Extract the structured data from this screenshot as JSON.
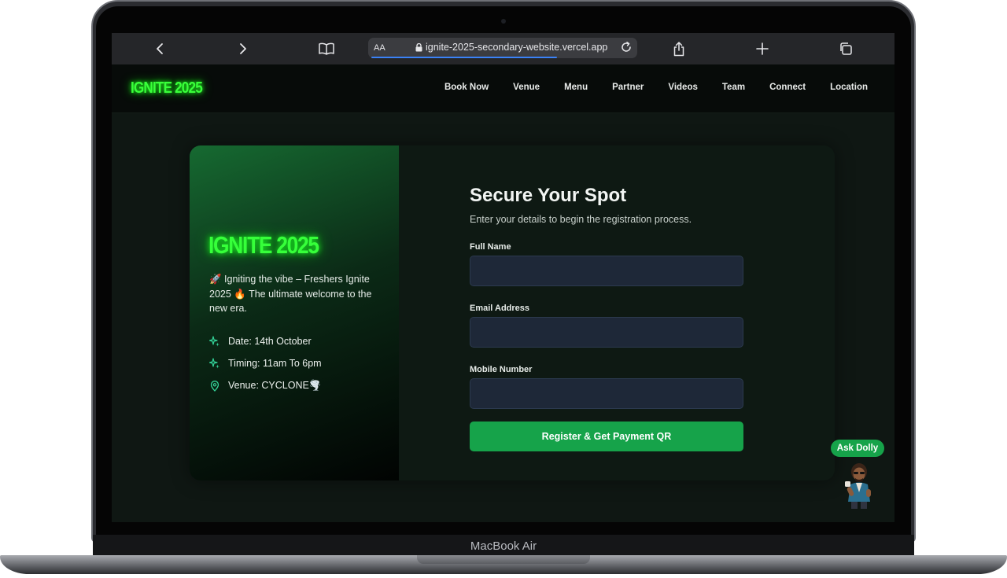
{
  "device": {
    "brand_label": "MacBook Air"
  },
  "browser": {
    "aa_label": "AA",
    "url": "ignite-2025-secondary-website.vercel.app",
    "icons": [
      "back-icon",
      "forward-icon",
      "book-icon",
      "lock-icon",
      "reload-icon",
      "share-icon",
      "plus-icon",
      "tabs-icon"
    ]
  },
  "site": {
    "logo": "IGNITE 2025",
    "nav": [
      "Book Now",
      "Venue",
      "Menu",
      "Partner",
      "Videos",
      "Team",
      "Connect",
      "Location"
    ]
  },
  "hero": {
    "title": "IGNITE 2025",
    "description": "🚀 Igniting the vibe – Freshers Ignite 2025 🔥 The ultimate welcome to the new era.",
    "date": "Date: 14th October",
    "timing": "Timing: 11am To 6pm",
    "venue": "Venue: CYCLONE🌪️"
  },
  "form": {
    "title": "Secure Your Spot",
    "subtitle": "Enter your details to begin the registration process.",
    "full_name_label": "Full Name",
    "full_name_value": "",
    "email_label": "Email Address",
    "email_value": "",
    "mobile_label": "Mobile Number",
    "mobile_value": "",
    "submit_label": "Register & Get Payment QR"
  },
  "assistant": {
    "label": "Ask Dolly"
  },
  "colors": {
    "neon_green": "#39ff3a",
    "accent_green": "#16a34a",
    "input_bg": "#1e2838",
    "page_bg": "#0f1713"
  }
}
